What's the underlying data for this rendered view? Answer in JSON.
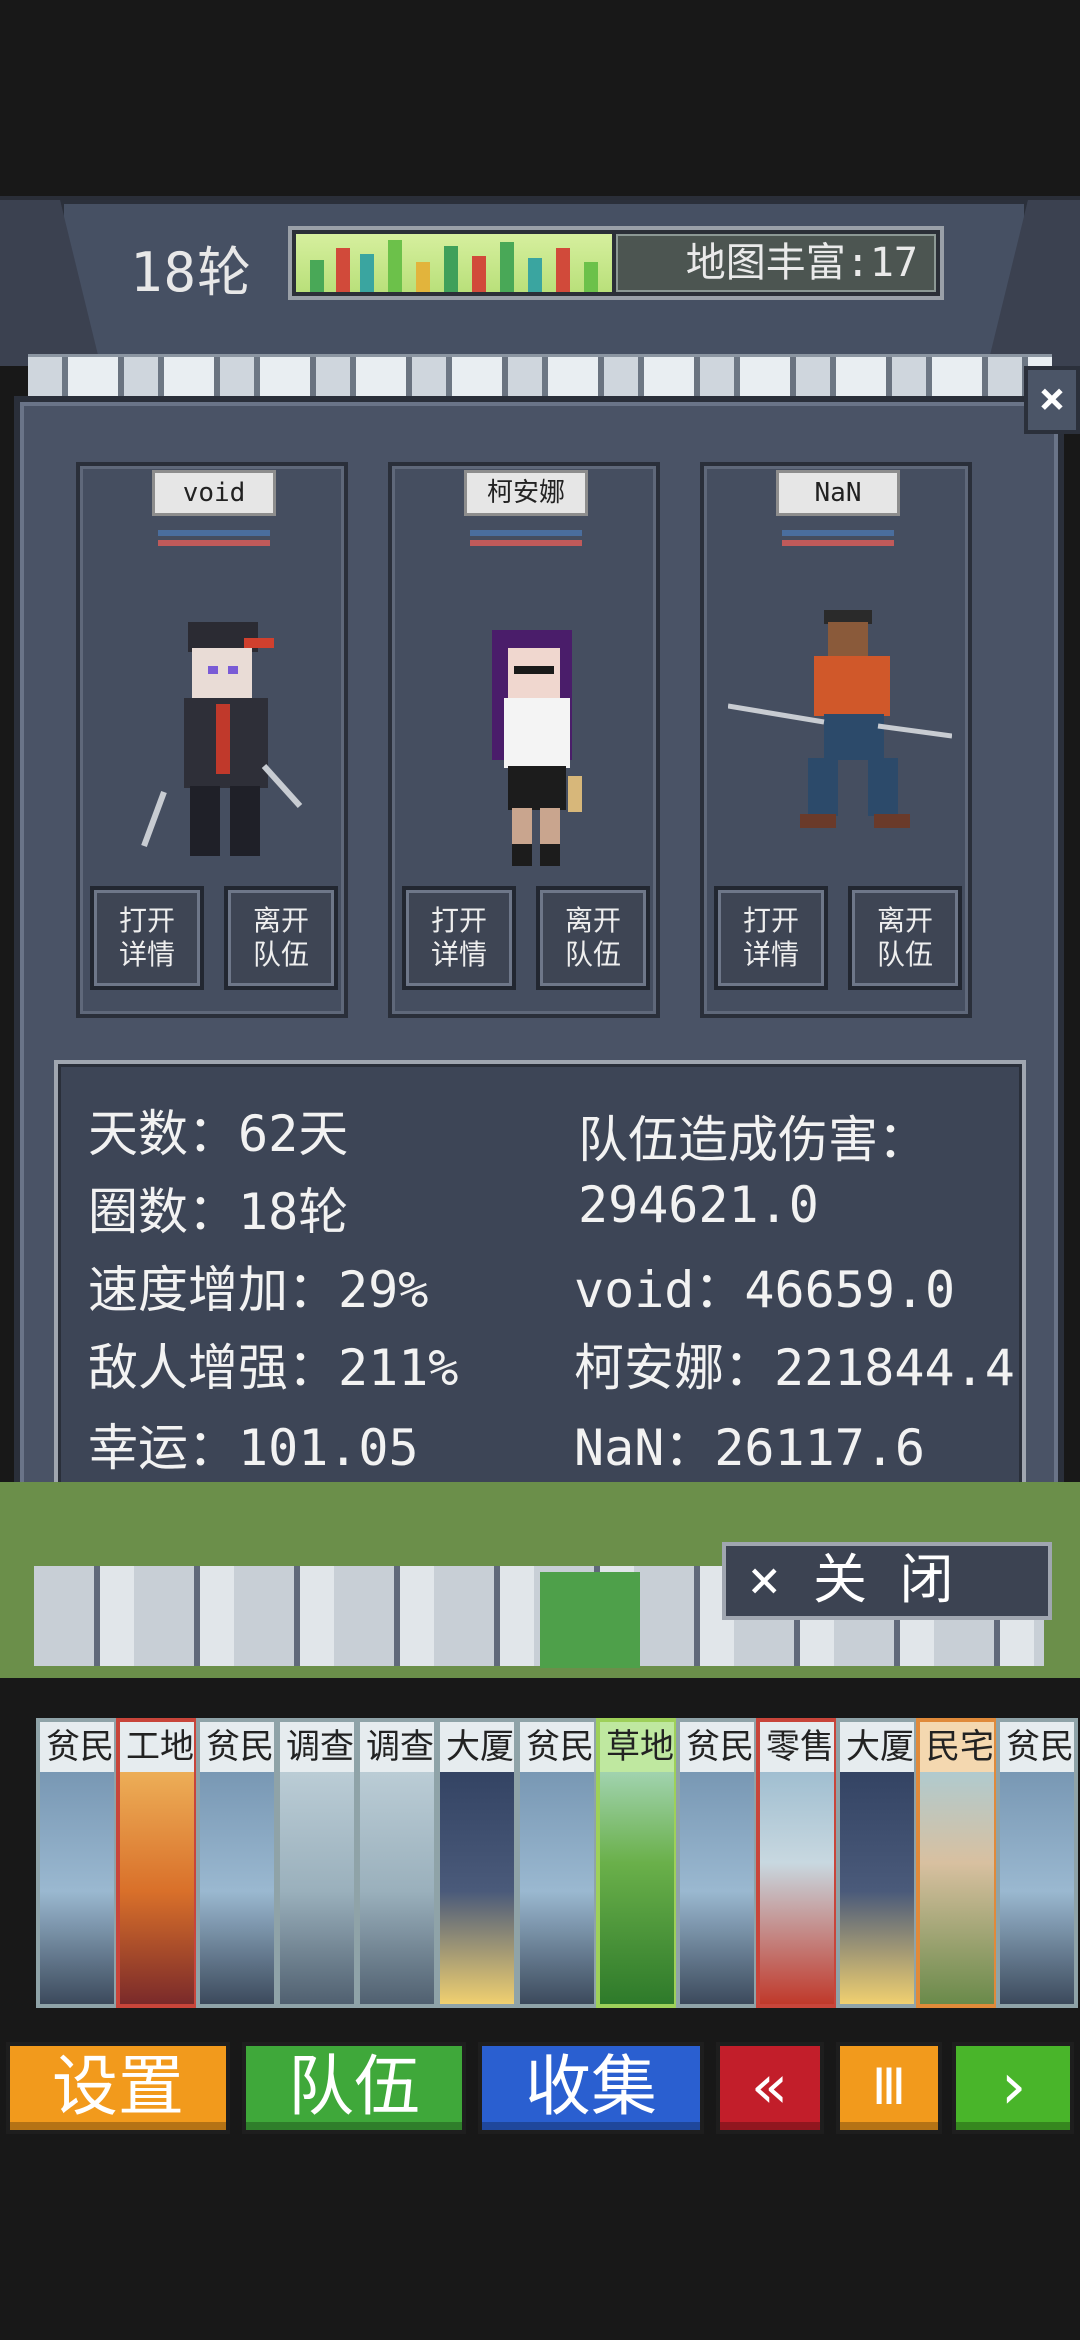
{
  "hud": {
    "round": "18轮",
    "map_richness": "地图丰富:17"
  },
  "panel": {
    "close_x": "×",
    "characters": [
      {
        "name": "void",
        "btn_open": [
          "打开",
          "详情"
        ],
        "btn_leave": [
          "离开",
          "队伍"
        ]
      },
      {
        "name": "柯安娜",
        "btn_open": [
          "打开",
          "详情"
        ],
        "btn_leave": [
          "离开",
          "队伍"
        ]
      },
      {
        "name": "NaN",
        "btn_open": [
          "打开",
          "详情"
        ],
        "btn_leave": [
          "离开",
          "队伍"
        ]
      }
    ],
    "stats_left": [
      "天数：62天",
      "圈数：18轮",
      "速度增加：29%",
      "敌人增强：211%",
      "幸运：101.05"
    ],
    "stats_right": [
      "队伍造成伤害：",
      "294621.0",
      "void：46659.0",
      "柯安娜：221844.4",
      "NaN：26117.6"
    ],
    "close_button": "× 关  闭"
  },
  "cards": [
    "贫民",
    "工地",
    "贫民",
    "调查",
    "调查",
    "大厦",
    "贫民",
    "草地",
    "贫民",
    "零售",
    "大厦",
    "民宅",
    "贫民"
  ],
  "bottom": {
    "settings": "设置",
    "team": "队伍",
    "collect": "收集",
    "rewind": "«",
    "pause": "Ⅲ",
    "forward": "›"
  },
  "colors": {
    "settings": "#f29a1c",
    "team": "#3fa83a",
    "collect": "#2a5fd0",
    "rewind": "#c21e2a",
    "pause": "#f29a1c",
    "forward": "#49b52a"
  }
}
